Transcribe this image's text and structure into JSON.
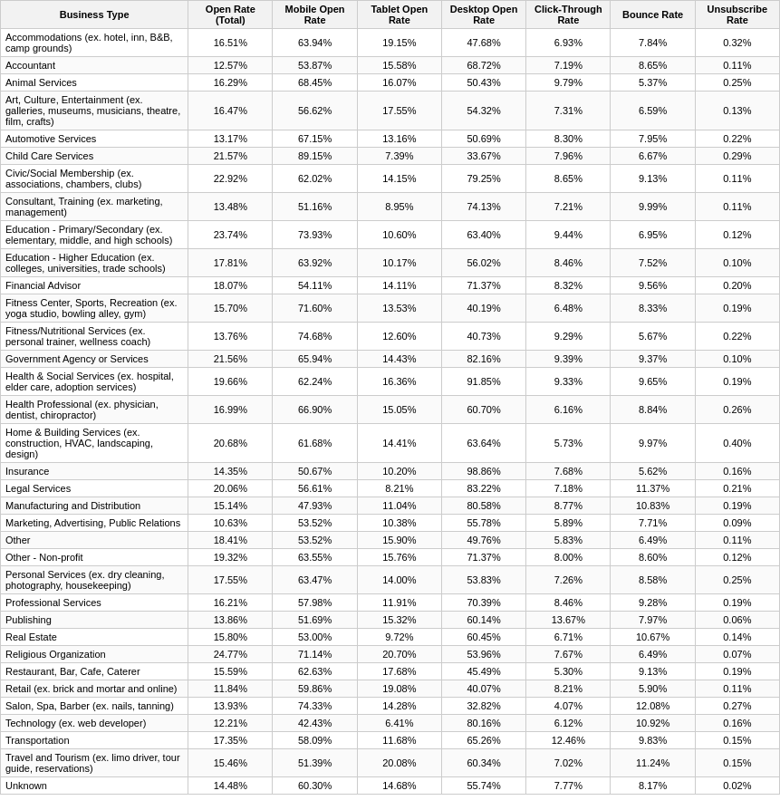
{
  "table": {
    "headers": [
      "Business Type",
      "Open Rate (Total)",
      "Mobile Open Rate",
      "Tablet Open Rate",
      "Desktop Open Rate",
      "Click-Through Rate",
      "Bounce Rate",
      "Unsubscribe Rate"
    ],
    "rows": [
      [
        "Accommodations (ex. hotel, inn, B&B, camp grounds)",
        "16.51%",
        "63.94%",
        "19.15%",
        "47.68%",
        "6.93%",
        "7.84%",
        "0.32%"
      ],
      [
        "Accountant",
        "12.57%",
        "53.87%",
        "15.58%",
        "68.72%",
        "7.19%",
        "8.65%",
        "0.11%"
      ],
      [
        "Animal Services",
        "16.29%",
        "68.45%",
        "16.07%",
        "50.43%",
        "9.79%",
        "5.37%",
        "0.25%"
      ],
      [
        "Art, Culture, Entertainment (ex. galleries, museums, musicians, theatre, film, crafts)",
        "16.47%",
        "56.62%",
        "17.55%",
        "54.32%",
        "7.31%",
        "6.59%",
        "0.13%"
      ],
      [
        "Automotive Services",
        "13.17%",
        "67.15%",
        "13.16%",
        "50.69%",
        "8.30%",
        "7.95%",
        "0.22%"
      ],
      [
        "Child Care Services",
        "21.57%",
        "89.15%",
        "7.39%",
        "33.67%",
        "7.96%",
        "6.67%",
        "0.29%"
      ],
      [
        "Civic/Social Membership (ex. associations, chambers, clubs)",
        "22.92%",
        "62.02%",
        "14.15%",
        "79.25%",
        "8.65%",
        "9.13%",
        "0.11%"
      ],
      [
        "Consultant, Training (ex. marketing, management)",
        "13.48%",
        "51.16%",
        "8.95%",
        "74.13%",
        "7.21%",
        "9.99%",
        "0.11%"
      ],
      [
        "Education - Primary/Secondary (ex. elementary, middle, and high schools)",
        "23.74%",
        "73.93%",
        "10.60%",
        "63.40%",
        "9.44%",
        "6.95%",
        "0.12%"
      ],
      [
        "Education - Higher Education (ex. colleges, universities, trade schools)",
        "17.81%",
        "63.92%",
        "10.17%",
        "56.02%",
        "8.46%",
        "7.52%",
        "0.10%"
      ],
      [
        "Financial Advisor",
        "18.07%",
        "54.11%",
        "14.11%",
        "71.37%",
        "8.32%",
        "9.56%",
        "0.20%"
      ],
      [
        "Fitness Center, Sports, Recreation (ex. yoga studio, bowling alley, gym)",
        "15.70%",
        "71.60%",
        "13.53%",
        "40.19%",
        "6.48%",
        "8.33%",
        "0.19%"
      ],
      [
        "Fitness/Nutritional Services (ex. personal trainer, wellness coach)",
        "13.76%",
        "74.68%",
        "12.60%",
        "40.73%",
        "9.29%",
        "5.67%",
        "0.22%"
      ],
      [
        "Government Agency or Services",
        "21.56%",
        "65.94%",
        "14.43%",
        "82.16%",
        "9.39%",
        "9.37%",
        "0.10%"
      ],
      [
        "Health & Social Services (ex. hospital, elder care, adoption services)",
        "19.66%",
        "62.24%",
        "16.36%",
        "91.85%",
        "9.33%",
        "9.65%",
        "0.19%"
      ],
      [
        "Health Professional (ex. physician, dentist, chiropractor)",
        "16.99%",
        "66.90%",
        "15.05%",
        "60.70%",
        "6.16%",
        "8.84%",
        "0.26%"
      ],
      [
        "Home & Building Services (ex. construction, HVAC, landscaping, design)",
        "20.68%",
        "61.68%",
        "14.41%",
        "63.64%",
        "5.73%",
        "9.97%",
        "0.40%"
      ],
      [
        "Insurance",
        "14.35%",
        "50.67%",
        "10.20%",
        "98.86%",
        "7.68%",
        "5.62%",
        "0.16%"
      ],
      [
        "Legal Services",
        "20.06%",
        "56.61%",
        "8.21%",
        "83.22%",
        "7.18%",
        "11.37%",
        "0.21%"
      ],
      [
        "Manufacturing and Distribution",
        "15.14%",
        "47.93%",
        "11.04%",
        "80.58%",
        "8.77%",
        "10.83%",
        "0.19%"
      ],
      [
        "Marketing, Advertising, Public Relations",
        "10.63%",
        "53.52%",
        "10.38%",
        "55.78%",
        "5.89%",
        "7.71%",
        "0.09%"
      ],
      [
        "Other",
        "18.41%",
        "53.52%",
        "15.90%",
        "49.76%",
        "5.83%",
        "6.49%",
        "0.11%"
      ],
      [
        "Other - Non-profit",
        "19.32%",
        "63.55%",
        "15.76%",
        "71.37%",
        "8.00%",
        "8.60%",
        "0.12%"
      ],
      [
        "Personal Services (ex. dry cleaning, photography, housekeeping)",
        "17.55%",
        "63.47%",
        "14.00%",
        "53.83%",
        "7.26%",
        "8.58%",
        "0.25%"
      ],
      [
        "Professional Services",
        "16.21%",
        "57.98%",
        "11.91%",
        "70.39%",
        "8.46%",
        "9.28%",
        "0.19%"
      ],
      [
        "Publishing",
        "13.86%",
        "51.69%",
        "15.32%",
        "60.14%",
        "13.67%",
        "7.97%",
        "0.06%"
      ],
      [
        "Real Estate",
        "15.80%",
        "53.00%",
        "9.72%",
        "60.45%",
        "6.71%",
        "10.67%",
        "0.14%"
      ],
      [
        "Religious Organization",
        "24.77%",
        "71.14%",
        "20.70%",
        "53.96%",
        "7.67%",
        "6.49%",
        "0.07%"
      ],
      [
        "Restaurant, Bar, Cafe, Caterer",
        "15.59%",
        "62.63%",
        "17.68%",
        "45.49%",
        "5.30%",
        "9.13%",
        "0.19%"
      ],
      [
        "Retail (ex. brick and mortar and online)",
        "11.84%",
        "59.86%",
        "19.08%",
        "40.07%",
        "8.21%",
        "5.90%",
        "0.11%"
      ],
      [
        "Salon, Spa, Barber (ex. nails, tanning)",
        "13.93%",
        "74.33%",
        "14.28%",
        "32.82%",
        "4.07%",
        "12.08%",
        "0.27%"
      ],
      [
        "Technology (ex. web developer)",
        "12.21%",
        "42.43%",
        "6.41%",
        "80.16%",
        "6.12%",
        "10.92%",
        "0.16%"
      ],
      [
        "Transportation",
        "17.35%",
        "58.09%",
        "11.68%",
        "65.26%",
        "12.46%",
        "9.83%",
        "0.15%"
      ],
      [
        "Travel and Tourism (ex. limo driver, tour guide, reservations)",
        "15.46%",
        "51.39%",
        "20.08%",
        "60.34%",
        "7.02%",
        "11.24%",
        "0.15%"
      ],
      [
        "Unknown",
        "14.48%",
        "60.30%",
        "14.68%",
        "55.74%",
        "7.77%",
        "8.17%",
        "0.02%"
      ]
    ]
  }
}
